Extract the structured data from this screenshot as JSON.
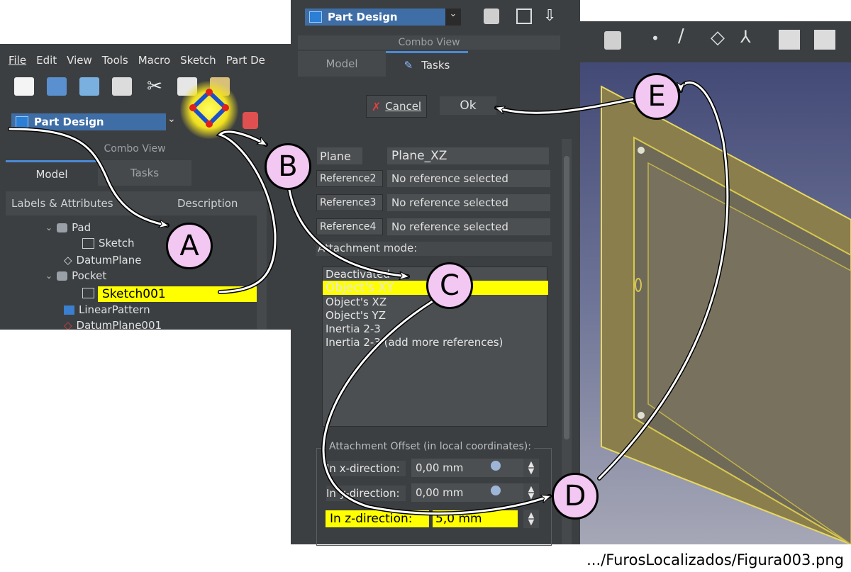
{
  "left_window": {
    "menu": [
      "File",
      "Edit",
      "View",
      "Tools",
      "Macro",
      "Sketch",
      "Part De"
    ],
    "workbench": "Part Design",
    "combo_view_title": "Combo View",
    "tabs": [
      "Model",
      "Tasks"
    ],
    "tree_header": [
      "Labels & Attributes",
      "Description"
    ],
    "tree_items": [
      "Pad",
      "Sketch",
      "DatumPlane",
      "Pocket",
      "Sketch001",
      "LinearPattern",
      "DatumPlane001"
    ]
  },
  "center_panel": {
    "workbench": "Part Design",
    "combo_view_title": "Combo View",
    "tabs": [
      "Model",
      "Tasks"
    ],
    "cancel_label": "Cancel",
    "ok_label": "Ok",
    "references": [
      {
        "label": "Plane",
        "value": "Plane_XZ"
      },
      {
        "label": "Reference2",
        "value": "No reference selected"
      },
      {
        "label": "Reference3",
        "value": "No reference selected"
      },
      {
        "label": "Reference4",
        "value": "No reference selected"
      }
    ],
    "attachment_mode_label": "Attachment mode:",
    "modes": [
      "Deactivated",
      "Object's XY",
      "Object's XZ",
      "Object's YZ",
      "Inertia 2-3",
      "Inertia 2-3 (add more references)"
    ],
    "offset_title": "Attachment Offset (in local coordinates):",
    "offsets": [
      {
        "label": "In x-direction:",
        "value": "0,00 mm"
      },
      {
        "label": "In y-direction:",
        "value": "0,00 mm"
      },
      {
        "label": "In z-direction:",
        "value": "5,0 mm"
      }
    ]
  },
  "callouts": [
    "A",
    "B",
    "C",
    "D",
    "E"
  ],
  "caption": ".../FurosLocalizados/Figura003.png",
  "colors": {
    "highlight": "#ffff00",
    "callout_fill": "#f2c7f2",
    "panel_bg": "#3c3f41",
    "accent": "#3f6ea6"
  }
}
